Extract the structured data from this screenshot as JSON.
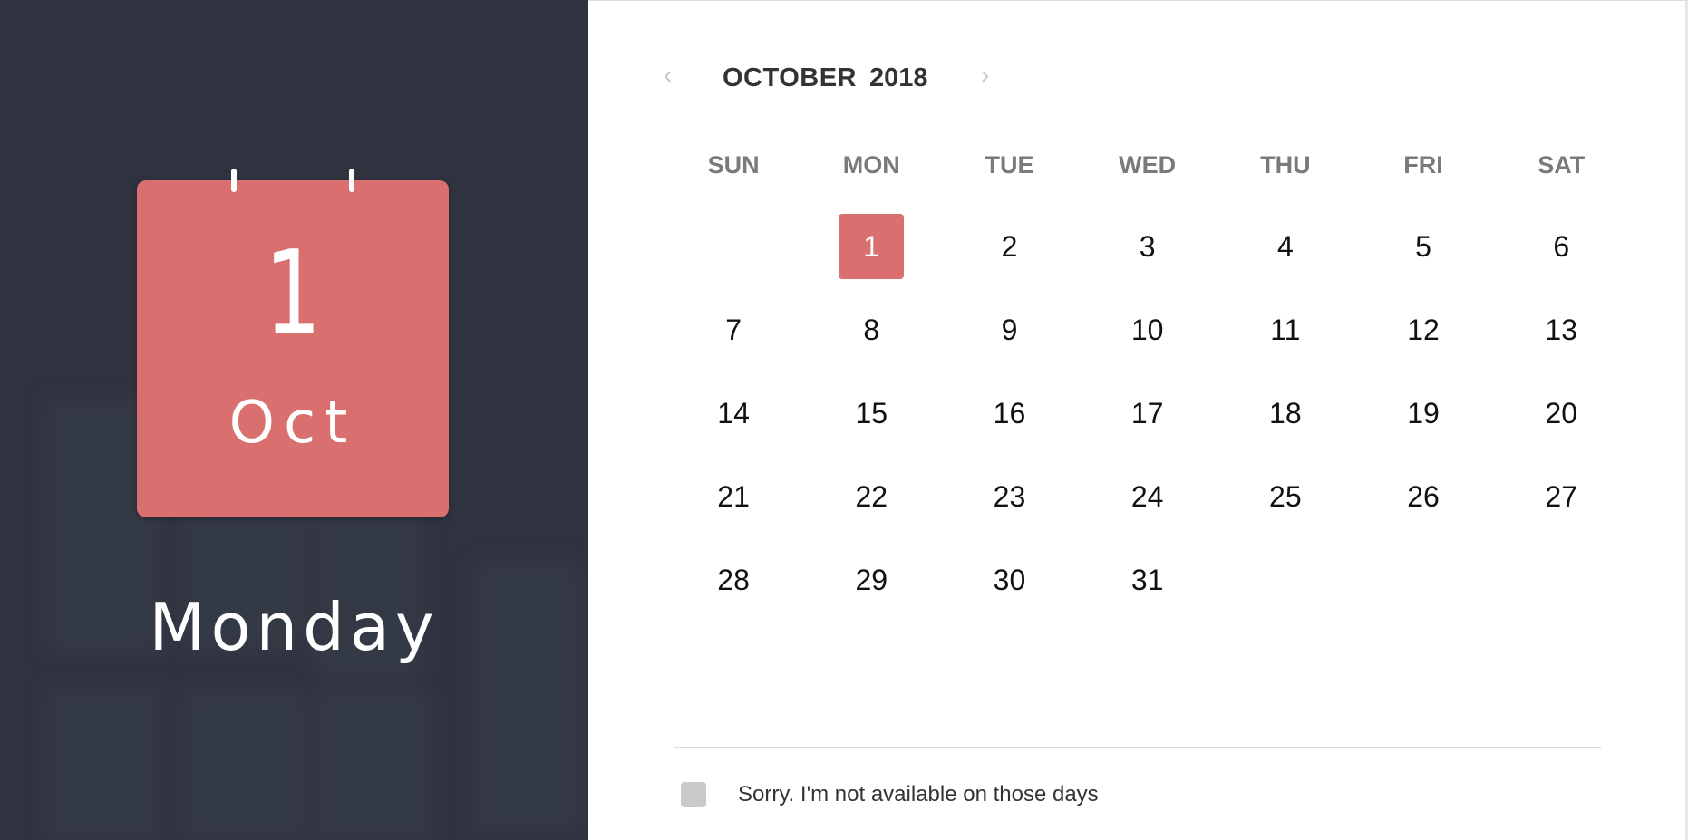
{
  "left": {
    "day_number": "1",
    "month_short": "Oct",
    "weekday": "Monday"
  },
  "header": {
    "prev_icon": "chevron-left-icon",
    "next_icon": "chevron-right-icon",
    "prev_glyph": "‹",
    "next_glyph": "›",
    "month": "OCTOBER",
    "year": "2018"
  },
  "weekdays": [
    "SUN",
    "MON",
    "TUE",
    "WED",
    "THU",
    "FRI",
    "SAT"
  ],
  "days": [
    "",
    "1",
    "2",
    "3",
    "4",
    "5",
    "6",
    "7",
    "8",
    "9",
    "10",
    "11",
    "12",
    "13",
    "14",
    "15",
    "16",
    "17",
    "18",
    "19",
    "20",
    "21",
    "22",
    "23",
    "24",
    "25",
    "26",
    "27",
    "28",
    "29",
    "30",
    "31"
  ],
  "selected_day": "1",
  "footer": {
    "checkbox_label": "Sorry. I'm not available on those days",
    "checked": false
  },
  "colors": {
    "accent": "#d96f6f",
    "left_bg": "#2f333f"
  }
}
